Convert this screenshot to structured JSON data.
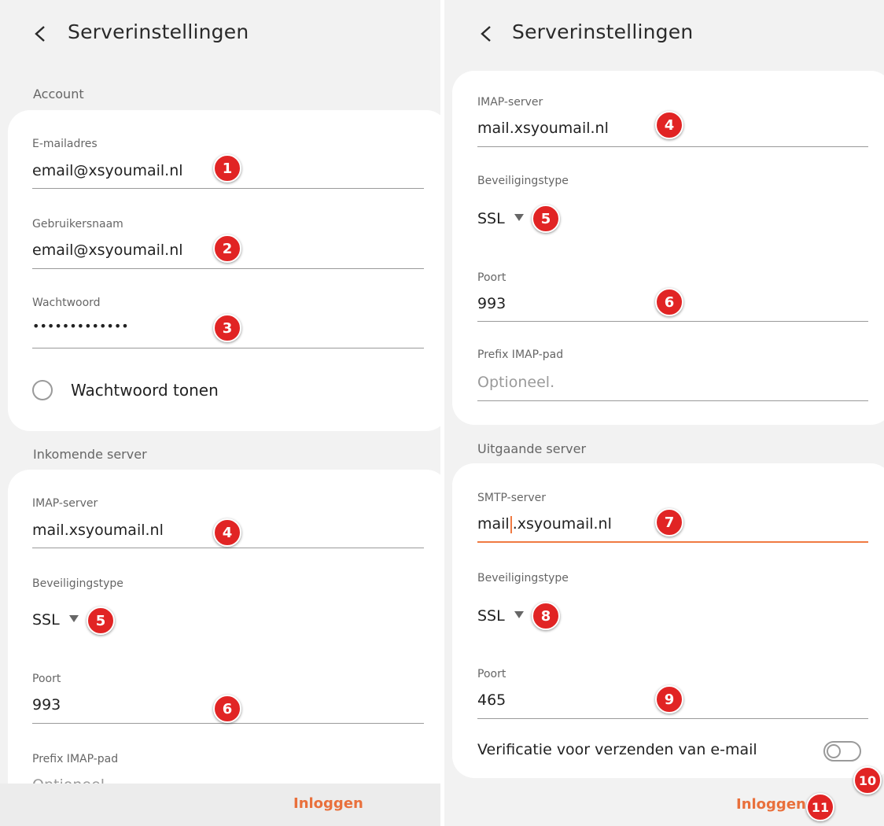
{
  "left": {
    "title": "Serverinstellingen",
    "account_label": "Account",
    "email": {
      "label": "E-mailadres",
      "value": "email@xsyoumail.nl",
      "badge": "1"
    },
    "username": {
      "label": "Gebruikersnaam",
      "value": "email@xsyoumail.nl",
      "badge": "2"
    },
    "password": {
      "label": "Wachtwoord",
      "value": "•••••••••••••",
      "badge": "3"
    },
    "show_password": "Wachtwoord tonen",
    "incoming_label": "Inkomende server",
    "imap": {
      "label": "IMAP-server",
      "value": "mail.xsyoumail.nl",
      "badge": "4"
    },
    "security": {
      "label": "Beveiligingstype",
      "value": "SSL",
      "badge": "5"
    },
    "port": {
      "label": "Poort",
      "value": "993",
      "badge": "6"
    },
    "prefix": {
      "label": "Prefix IMAP-pad",
      "value": "Optioneel."
    },
    "login": "Inloggen"
  },
  "right": {
    "title": "Serverinstellingen",
    "imap": {
      "label": "IMAP-server",
      "value": "mail.xsyoumail.nl",
      "badge": "4"
    },
    "security": {
      "label": "Beveiligingstype",
      "value": "SSL",
      "badge": "5"
    },
    "port": {
      "label": "Poort",
      "value": "993",
      "badge": "6"
    },
    "prefix": {
      "label": "Prefix IMAP-pad",
      "placeholder": "Optioneel."
    },
    "outgoing_label": "Uitgaande server",
    "smtp": {
      "label": "SMTP-server",
      "value_before_cursor": "mail",
      "value_after_cursor": ".xsyoumail.nl",
      "badge": "7"
    },
    "smtp_security": {
      "label": "Beveiligingstype",
      "value": "SSL",
      "badge": "8"
    },
    "smtp_port": {
      "label": "Poort",
      "value": "465",
      "badge": "9"
    },
    "verification": {
      "label": "Verificatie voor verzenden van e-mail",
      "badge": "10"
    },
    "login": "Inloggen",
    "login_badge": "11"
  },
  "colors": {
    "accent": "#f07a42",
    "badge": "#e12424",
    "background": "#f2f2f2",
    "card": "#ffffff"
  },
  "icons": {
    "back": "chevron-left-icon",
    "dropdown": "caret-down-icon"
  }
}
